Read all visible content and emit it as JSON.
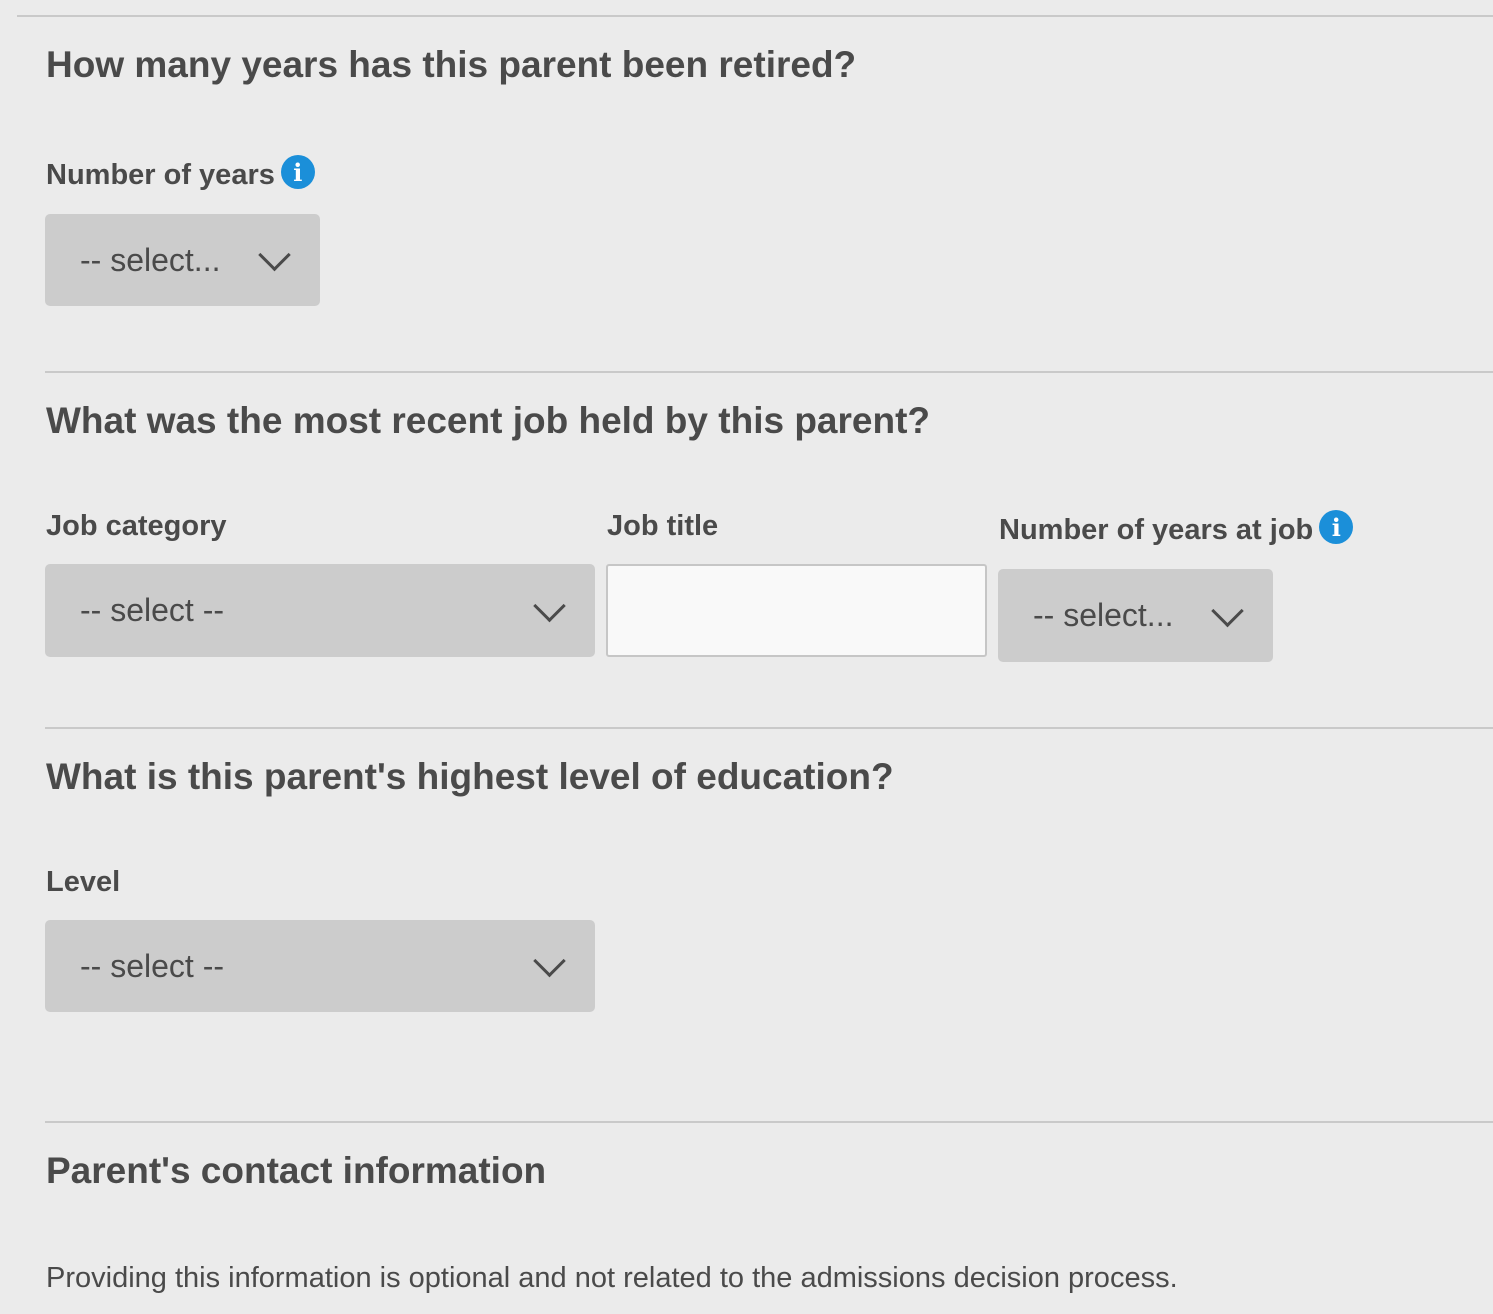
{
  "retired": {
    "question": "How many years has this parent been retired?",
    "years_label": "Number of years",
    "years_select_value": "-- select..."
  },
  "recent_job": {
    "question": "What was the most recent job held by this parent?",
    "category_label": "Job category",
    "category_select_value": "-- select --",
    "title_label": "Job title",
    "title_value": "",
    "years_at_job_label": "Number of years at job",
    "years_at_job_select_value": "-- select..."
  },
  "education": {
    "question": "What is this parent's highest level of education?",
    "level_label": "Level",
    "level_select_value": "-- select --"
  },
  "contact": {
    "heading": "Parent's contact information",
    "note": "Providing this information is optional and not related to the admissions decision process."
  },
  "icons": {
    "info_glyph": "i"
  },
  "colors": {
    "background": "#ebebeb",
    "select_bg": "#cccccc",
    "info_icon": "#1b8fd9",
    "text": "#4a4a4a"
  }
}
